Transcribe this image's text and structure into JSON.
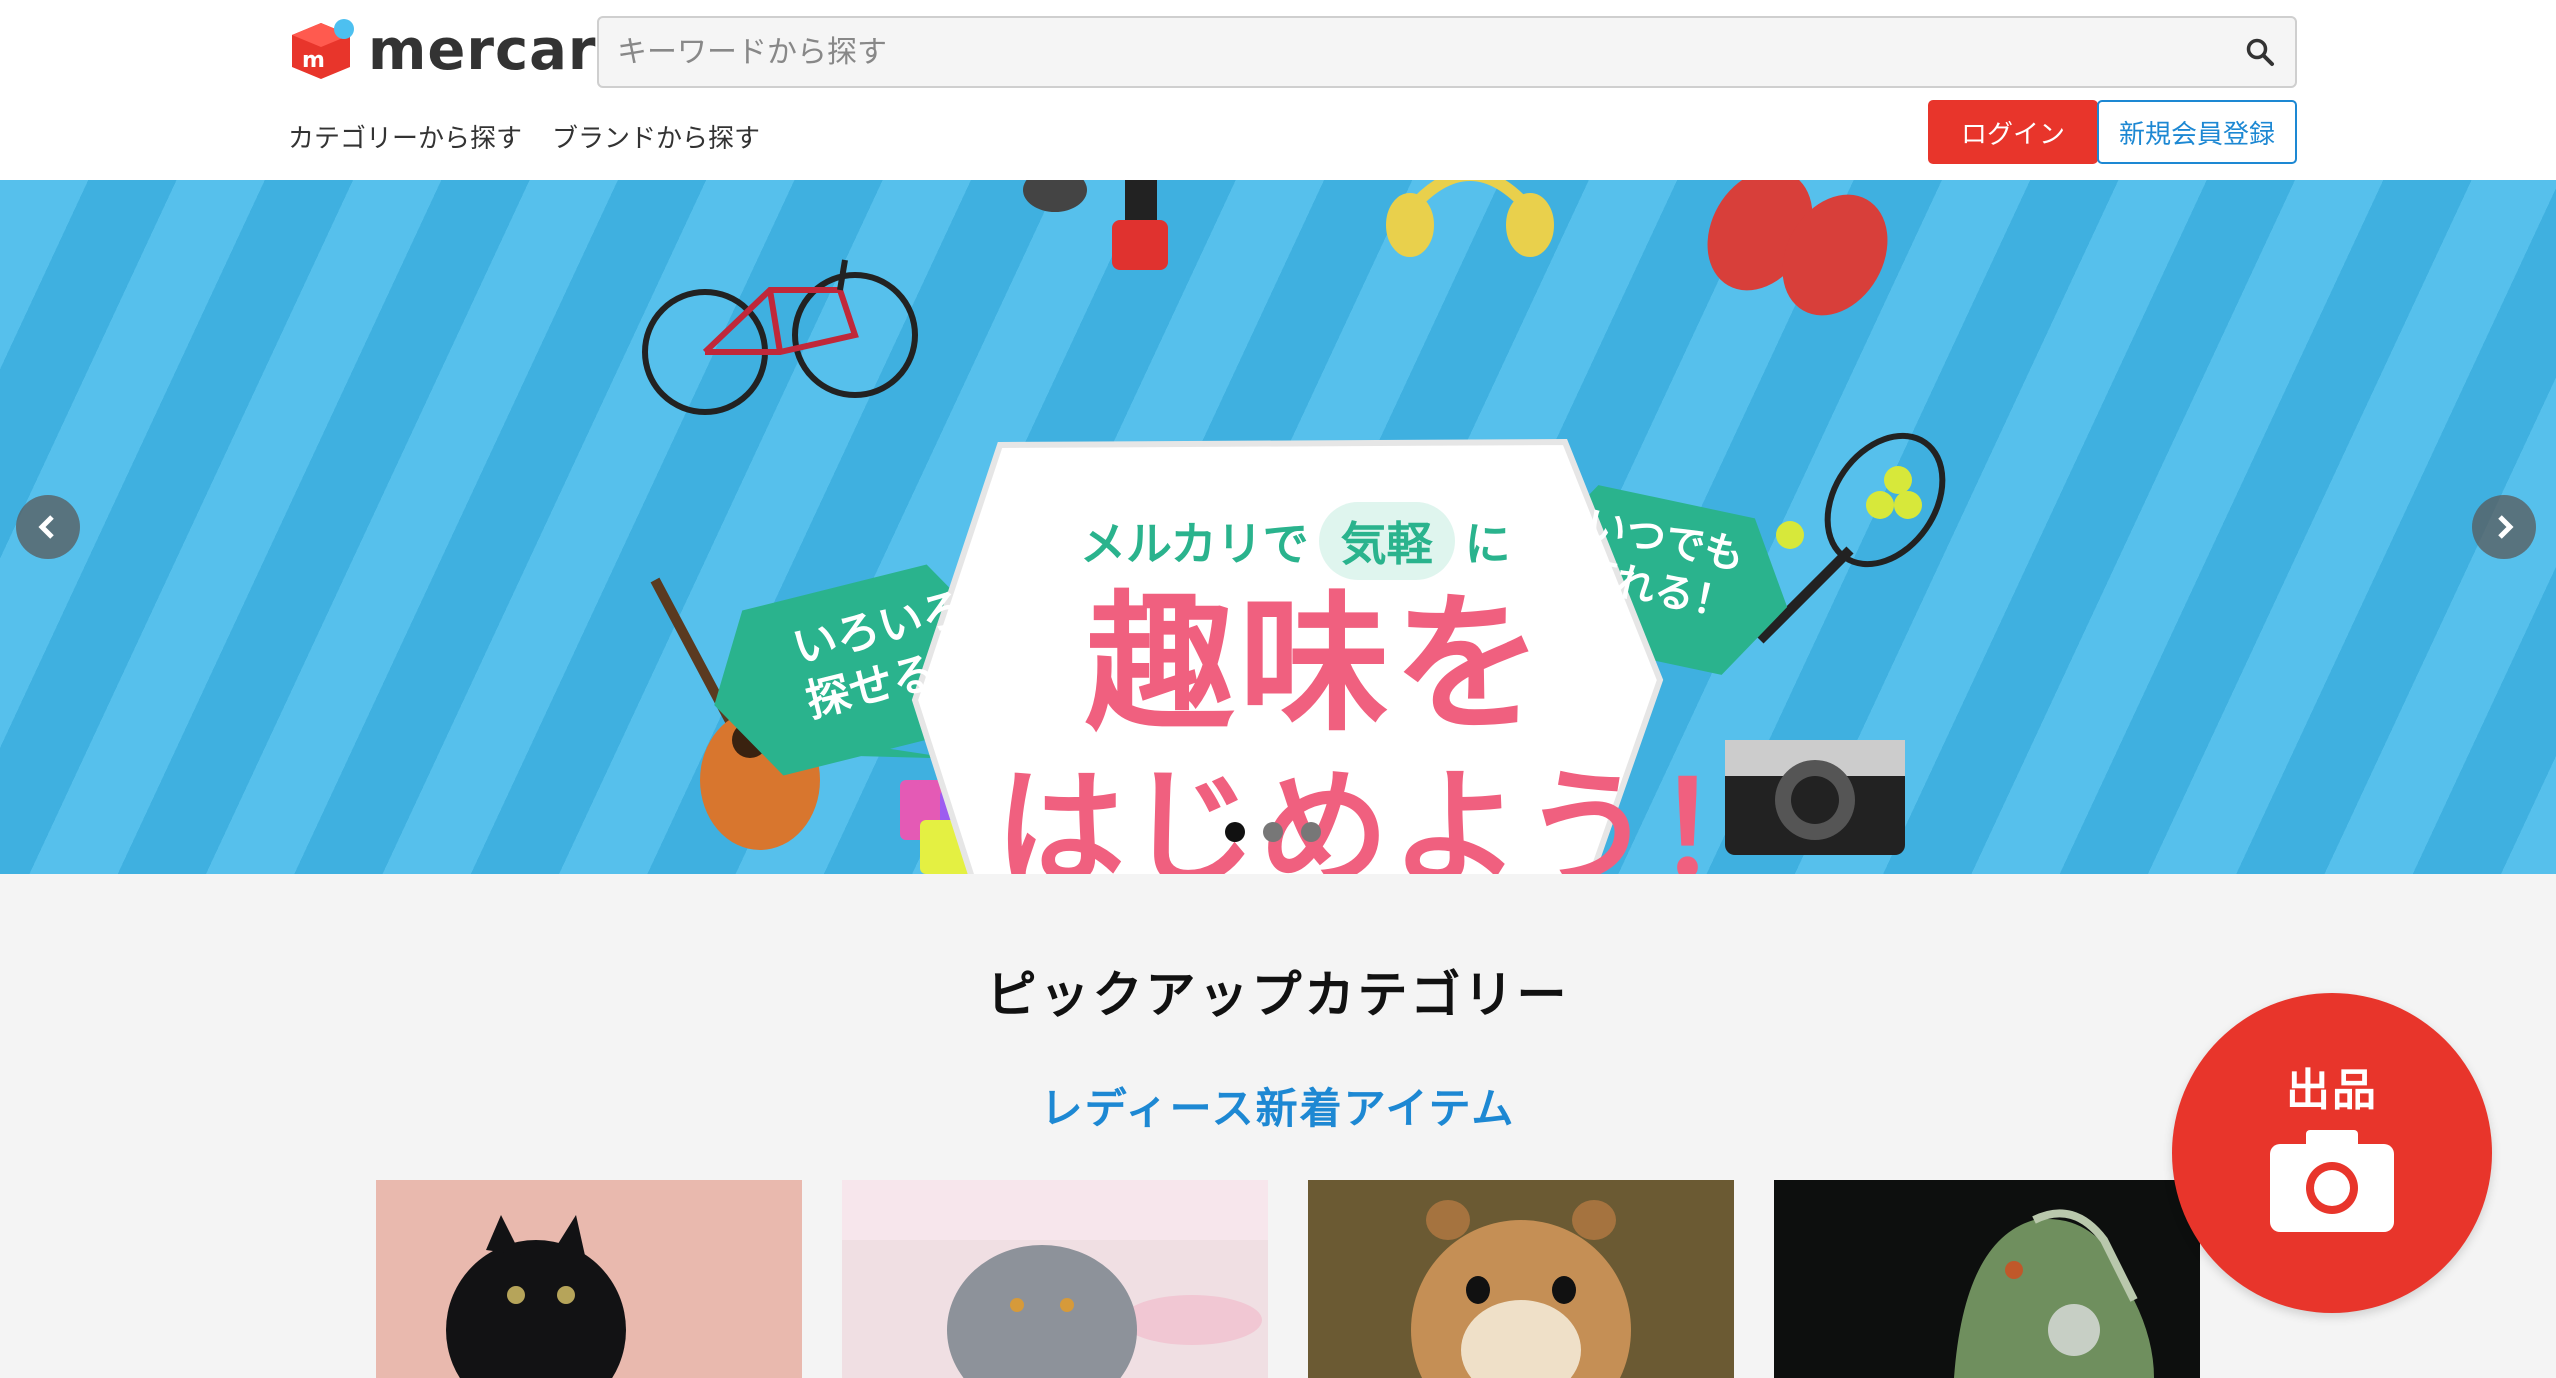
{
  "header": {
    "logo_text": "mercari",
    "search_placeholder": "キーワードから探す",
    "nav": [
      {
        "label": "カテゴリーから探す"
      },
      {
        "label": "ブランドから探す"
      }
    ],
    "login_label": "ログイン",
    "signup_label": "新規会員登録"
  },
  "banner": {
    "line1_prefix": "メルカリで",
    "line1_badge": "気軽",
    "line1_suffix": "に",
    "line2": "趣味を",
    "line3": "はじめよう！",
    "left_bubble": [
      "いろいろ",
      "探せる！"
    ],
    "right_bubble": [
      "いつでも",
      "売れる！"
    ],
    "slides_count": 3,
    "active_slide": 1
  },
  "pickup": {
    "title": "ピックアップカテゴリー",
    "subtitle": "レディース新着アイテム"
  },
  "fab": {
    "label": "出品"
  },
  "colors": {
    "brand_red": "#e8352b",
    "link_blue": "#1d88d3",
    "banner_blue": "#4bb7e6",
    "pink_text": "#f0607f",
    "bubble_green": "#2ab38d"
  }
}
